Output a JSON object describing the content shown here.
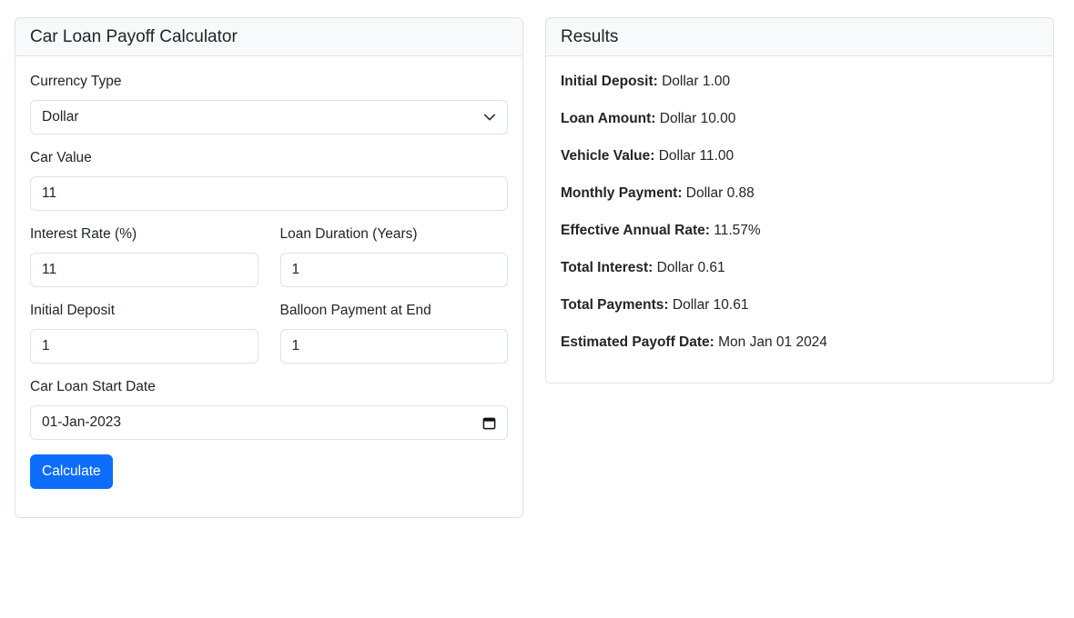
{
  "calculator": {
    "title": "Car Loan Payoff Calculator",
    "currency": {
      "label": "Currency Type",
      "value": "Dollar"
    },
    "car_value": {
      "label": "Car Value",
      "value": "11"
    },
    "interest_rate": {
      "label": "Interest Rate (%)",
      "value": "11"
    },
    "loan_duration": {
      "label": "Loan Duration (Years)",
      "value": "1"
    },
    "initial_deposit": {
      "label": "Initial Deposit",
      "value": "1"
    },
    "balloon_payment": {
      "label": "Balloon Payment at End",
      "value": "1"
    },
    "start_date": {
      "label": "Car Loan Start Date",
      "value": "01-Jan-2023"
    },
    "calculate_label": "Calculate"
  },
  "results": {
    "title": "Results",
    "items": [
      {
        "label": "Initial Deposit:",
        "value": "Dollar 1.00"
      },
      {
        "label": "Loan Amount:",
        "value": "Dollar 10.00"
      },
      {
        "label": "Vehicle Value:",
        "value": "Dollar 11.00"
      },
      {
        "label": "Monthly Payment:",
        "value": "Dollar 0.88"
      },
      {
        "label": "Effective Annual Rate:",
        "value": "11.57%"
      },
      {
        "label": "Total Interest:",
        "value": "Dollar 0.61"
      },
      {
        "label": "Total Payments:",
        "value": "Dollar 10.61"
      },
      {
        "label": "Estimated Payoff Date:",
        "value": "Mon Jan 01 2024"
      }
    ]
  },
  "icons": {
    "select": "chevron-down-icon",
    "date": "calendar-icon"
  },
  "colors": {
    "primary": "#0d6efd",
    "border": "#dee2e6",
    "header_bg": "#f8f9fa"
  }
}
